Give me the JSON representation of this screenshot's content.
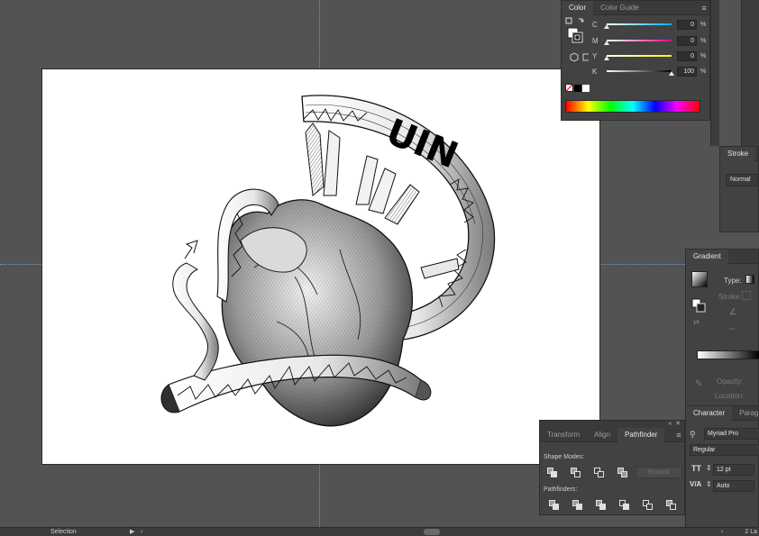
{
  "color_panel": {
    "tabs": [
      "Color",
      "Color Guide"
    ],
    "channels": [
      {
        "label": "C",
        "value": "0",
        "unit": "%",
        "level": 0
      },
      {
        "label": "M",
        "value": "0",
        "unit": "%",
        "level": 0
      },
      {
        "label": "Y",
        "value": "0",
        "unit": "%",
        "level": 0
      },
      {
        "label": "K",
        "value": "100",
        "unit": "%",
        "level": 1
      }
    ]
  },
  "stroke_panel": {
    "tab": "Stroke",
    "blend_mode": "Normal"
  },
  "gradient_panel": {
    "tab": "Gradient",
    "type_label": "Type:",
    "stroke_label": "Stroke:",
    "opacity_label": "Opacity:",
    "location_label": "Location:"
  },
  "character_panel": {
    "tabs": [
      "Character",
      "Paragrap"
    ],
    "font_family": "Myriad Pro",
    "font_style": "Regular",
    "font_size": "12 pt",
    "leading": "Auto"
  },
  "pathfinder_panel": {
    "tabs": [
      "Transform",
      "Align",
      "Pathfinder"
    ],
    "active_tab": "Pathfinder",
    "shape_modes_label": "Shape Modes:",
    "pathfinders_label": "Pathfinders:",
    "expand_label": "Expand"
  },
  "artwork": {
    "banner_text": "UIN"
  },
  "status_bar": {
    "tool": "Selection",
    "layers": "2 La"
  }
}
